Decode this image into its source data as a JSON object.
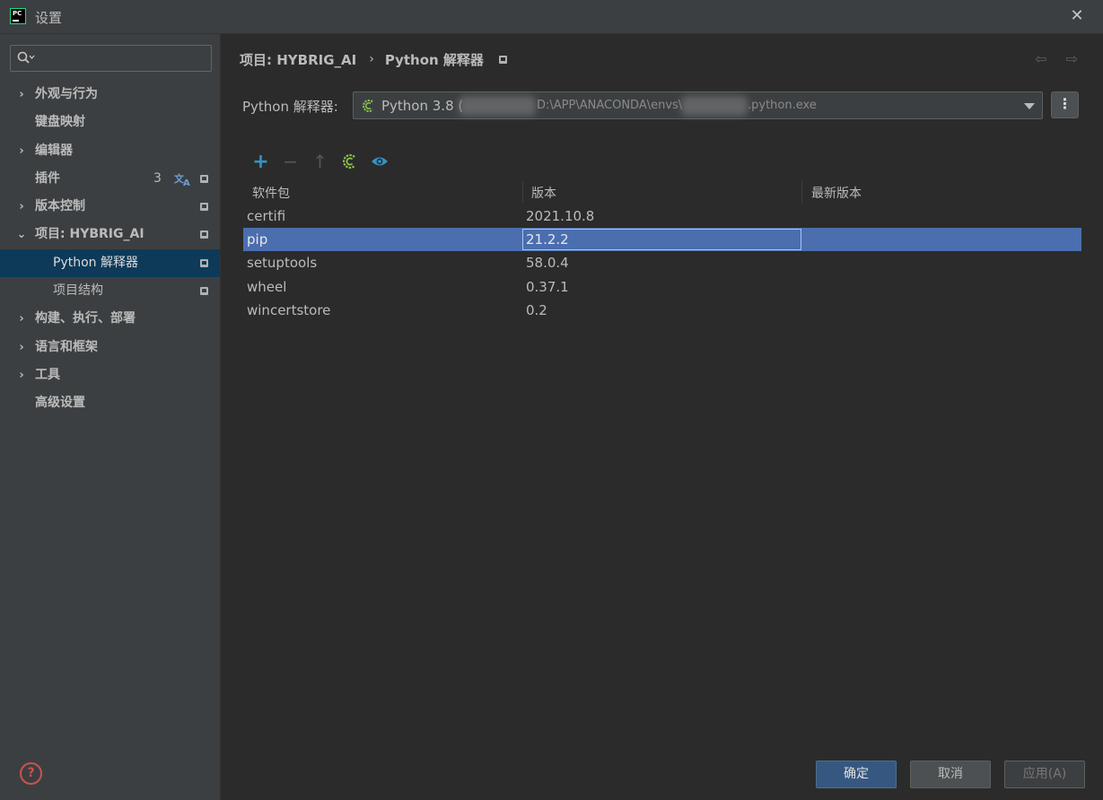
{
  "window": {
    "logo_text": "PC",
    "title": "设置",
    "close_glyph": "✕"
  },
  "search": {
    "placeholder": "",
    "value": ""
  },
  "sidebar": {
    "items": [
      {
        "label": "外观与行为",
        "chevron": "›"
      },
      {
        "label": "键盘映射",
        "chevron": ""
      },
      {
        "label": "编辑器",
        "chevron": "›"
      },
      {
        "label": "插件",
        "chevron": "",
        "count": "3"
      },
      {
        "label": "版本控制",
        "chevron": "›"
      },
      {
        "label": "项目: HYBRIG_AI",
        "chevron": "⌄"
      },
      {
        "label": "Python 解释器",
        "chevron": "",
        "selected": true
      },
      {
        "label": "项目结构",
        "chevron": ""
      },
      {
        "label": "构建、执行、部署",
        "chevron": "›"
      },
      {
        "label": "语言和框架",
        "chevron": "›"
      },
      {
        "label": "工具",
        "chevron": "›"
      },
      {
        "label": "高级设置",
        "chevron": ""
      }
    ],
    "help_glyph": "?"
  },
  "breadcrumb": {
    "project": "项目: HYBRIG_AI",
    "separator": "›",
    "page": "Python 解释器",
    "back_glyph": "⇦",
    "forward_glyph": "⇨"
  },
  "interpreter": {
    "label": "Python 解释器:",
    "name": "Python 3.8 (",
    "path_part1": "D:\\APP\\ANACONDA\\envs\\",
    "path_part2": ".python.exe",
    "more_glyph": "⋮"
  },
  "toolbar": {
    "add_glyph": "+",
    "remove_glyph": "−",
    "upgrade_glyph": "↑"
  },
  "table": {
    "headers": [
      "软件包",
      "版本",
      "最新版本"
    ],
    "rows": [
      {
        "package": "certifi",
        "version": "2021.10.8",
        "latest": ""
      },
      {
        "package": "pip",
        "version": "21.2.2",
        "latest": ""
      },
      {
        "package": "setuptools",
        "version": "58.0.4",
        "latest": ""
      },
      {
        "package": "wheel",
        "version": "0.37.1",
        "latest": ""
      },
      {
        "package": "wincertstore",
        "version": "0.2",
        "latest": ""
      }
    ],
    "selected_row": 1
  },
  "buttons": {
    "ok": "确定",
    "cancel": "取消",
    "apply": "应用(A)"
  },
  "colors": {
    "accent": "#3592c4",
    "selection": "#4b6eaf",
    "sidebar_selection": "#0d3a58",
    "primary_button": "#365880",
    "help": "#c75450",
    "python_icon": "#8bc34a"
  }
}
